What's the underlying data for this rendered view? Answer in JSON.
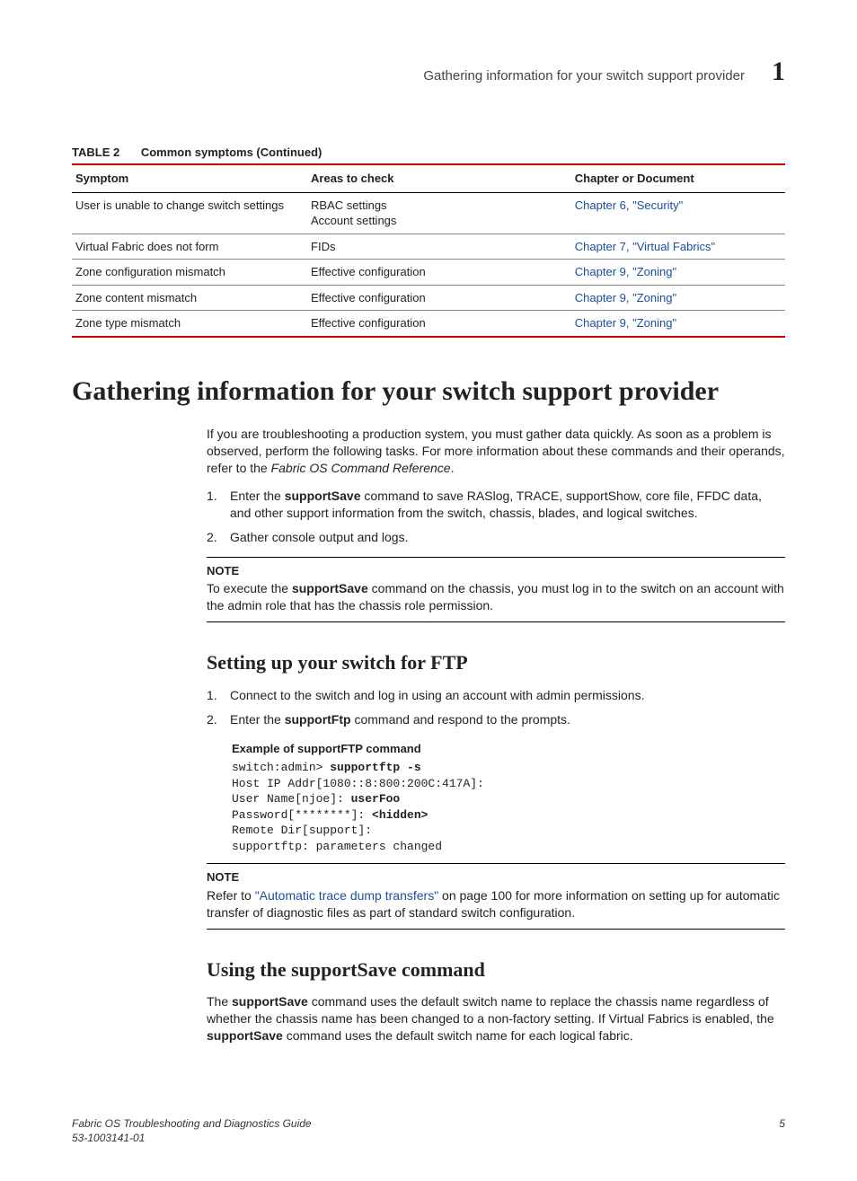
{
  "header": {
    "running_title": "Gathering information for your switch support provider",
    "chapter_num": "1"
  },
  "table": {
    "label": "TABLE 2",
    "caption": "Common symptoms  (Continued)",
    "cols": [
      "Symptom",
      "Areas to check",
      "Chapter or Document"
    ],
    "rows": [
      {
        "c0": "User is unable to change switch settings",
        "c1": "RBAC settings\nAccount settings",
        "c2": "Chapter 6, \"Security\""
      },
      {
        "c0": "Virtual Fabric does not form",
        "c1": "FIDs",
        "c2": "Chapter 7, \"Virtual Fabrics\""
      },
      {
        "c0": "Zone configuration mismatch",
        "c1": "Effective configuration",
        "c2": "Chapter 9, \"Zoning\""
      },
      {
        "c0": "Zone content mismatch",
        "c1": "Effective configuration",
        "c2": "Chapter 9, \"Zoning\""
      },
      {
        "c0": "Zone type mismatch",
        "c1": "Effective configuration",
        "c2": "Chapter 9, \"Zoning\""
      }
    ]
  },
  "h1": "Gathering information for your switch support provider",
  "intro": {
    "pre": "If you are troubleshooting a production system, you must gather data quickly. As soon as a problem is observed, perform the following tasks. For more information about these commands and their operands, refer to the ",
    "ref": "Fabric OS Command Reference",
    "post": "."
  },
  "steps1": {
    "s1a": "Enter the ",
    "s1b": "supportSave",
    "s1c": " command to save RASlog, TRACE, supportShow, core file, FFDC data, and other support information from the switch, chassis, blades, and logical switches.",
    "s2": "Gather console output and logs."
  },
  "note1": {
    "label": "NOTE",
    "a": "To execute the ",
    "b": "supportSave",
    "c": " command on the chassis, you must log in to the switch on an account with the admin role that has the chassis role permission."
  },
  "h2a": "Setting up your switch for FTP",
  "ftp_steps": {
    "s1": "Connect to the switch and log in using an account with admin permissions.",
    "s2a": "Enter the ",
    "s2b": "supportFtp",
    "s2c": " command and respond to the prompts."
  },
  "example_label": "Example  of supportFTP command",
  "code": {
    "l1a": "switch:admin> ",
    "l1b": "supportftp -s",
    "l2": "Host IP Addr[1080::8:800:200C:417A]:",
    "l3a": "User Name[njoe]: ",
    "l3b": "userFoo",
    "l4a": "Password[********]: ",
    "l4b": "<hidden>",
    "l5": "Remote Dir[support]:",
    "l6": "supportftp: parameters changed"
  },
  "note2": {
    "label": "NOTE",
    "a": "Refer to ",
    "link": "\"Automatic trace dump transfers\"",
    "b": " on page 100 for more information on setting up for automatic transfer of diagnostic files as part of standard switch configuration."
  },
  "h2b": "Using the supportSave command",
  "ss_para": {
    "a": "The ",
    "b": "supportSave",
    "c": " command uses the default switch name to replace the chassis name regardless of whether the chassis name has been changed to a non-factory setting. If Virtual Fabrics is enabled, the ",
    "d": "supportSave",
    "e": " command uses the default switch name for each logical fabric."
  },
  "footer": {
    "title": "Fabric OS Troubleshooting and Diagnostics Guide",
    "docnum": "53-1003141-01",
    "page": "5"
  }
}
